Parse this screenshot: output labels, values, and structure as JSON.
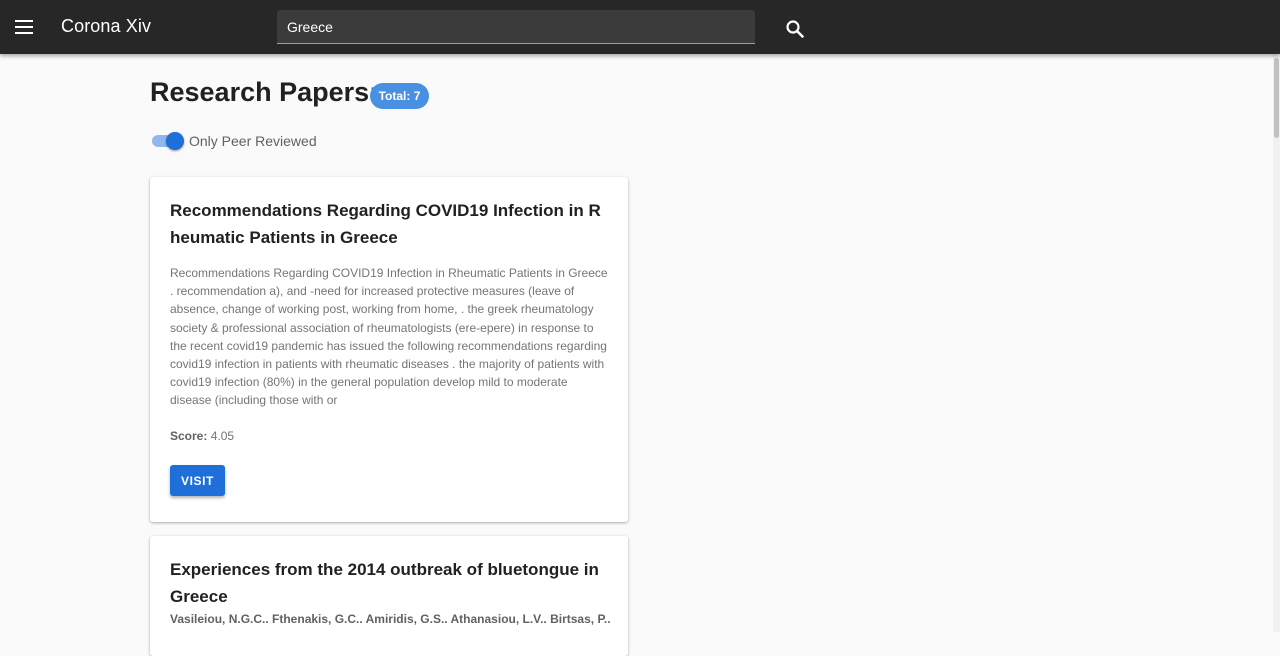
{
  "app": {
    "title": "Corona Xiv"
  },
  "search": {
    "value": "Greece",
    "placeholder": ""
  },
  "main": {
    "heading": "Research Papers:",
    "total_badge": "Total: 7",
    "filter_label": "Only Peer Reviewed",
    "filter_on": true
  },
  "papers": [
    {
      "title": "Recommendations Regarding COVID19 Infection in Rheumatic Patients in Greece",
      "abstract": "Recommendations Regarding COVID19 Infection in Rheumatic Patients in Greece . recommendation a), and -need for increased protective measures (leave of absence, change of working post, working from home, . the greek rheumatology society & professional association of rheumatologists (ere-epere) in response to the recent covid19 pandemic has issued the following recommendations regarding covid19 infection in patients with rheumatic diseases . the majority of patients with covid19 infection (80%) in the general population develop mild to moderate disease (including those with or",
      "score_label": "Score:",
      "score": "4.05",
      "button": "VISIT"
    },
    {
      "title": "Experiences from the 2014 outbreak of bluetongue in Greece",
      "authors": "Vasileiou, N.G.C.. Fthenakis, G.C.. Amiridis, G.S.. Athanasiou, L.V.. Birtsas, P.."
    }
  ],
  "colors": {
    "appbar": "#272727",
    "accent": "#1e6fd9",
    "badge": "#4a90e2"
  },
  "icons": {
    "menu": "menu-icon",
    "search": "search-icon"
  }
}
